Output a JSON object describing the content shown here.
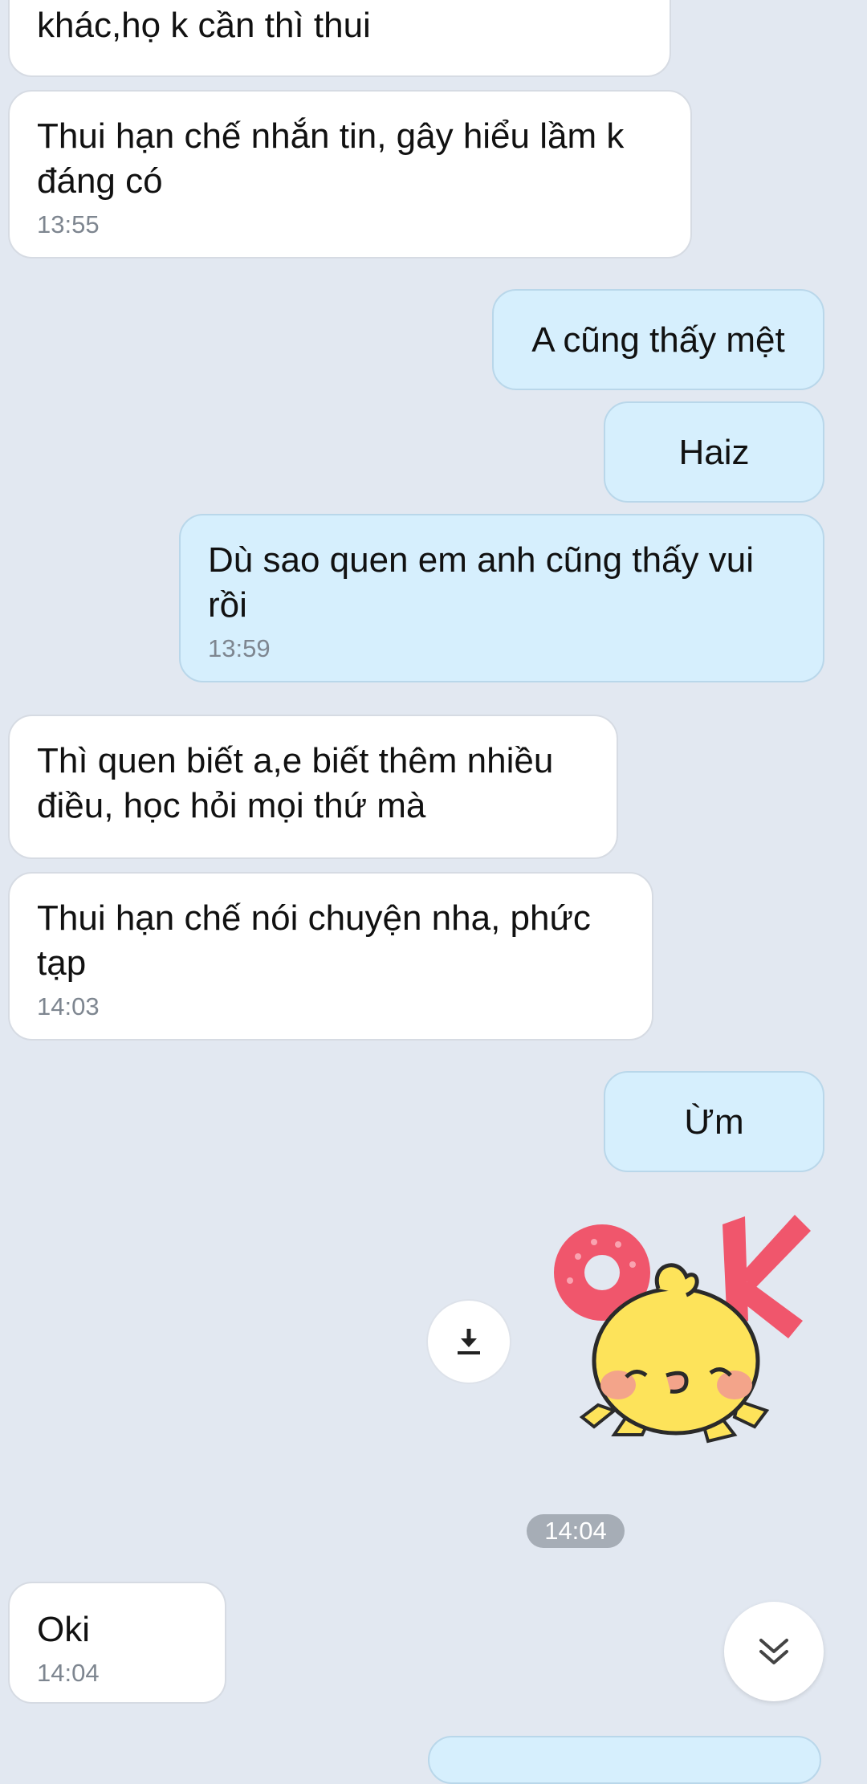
{
  "messages": [
    {
      "side": "in",
      "text": "khác,họ k cần thì thui",
      "time": ""
    },
    {
      "side": "in",
      "text": "Thui hạn chế nhắn tin, gây hiểu lầm k đáng có",
      "time": "13:55"
    },
    {
      "side": "out",
      "text": "A cũng thấy mệt",
      "time": ""
    },
    {
      "side": "out",
      "text": "Haiz",
      "time": ""
    },
    {
      "side": "out",
      "text": "Dù sao quen em anh cũng thấy vui rồi",
      "time": "13:59"
    },
    {
      "side": "in",
      "text": "Thì quen biết a,e biết thêm nhiều điều, học hỏi mọi thứ mà",
      "time": ""
    },
    {
      "side": "in",
      "text": "Thui hạn chế nói chuyện nha, phức tạp",
      "time": "14:03"
    },
    {
      "side": "out",
      "text": "Ừm",
      "time": ""
    },
    {
      "side": "in",
      "text": "Oki",
      "time": "14:04"
    }
  ],
  "sticker": {
    "time": "14:04",
    "text": "OK"
  },
  "icons": {
    "download": "download-icon",
    "scroll": "chevron-double-down-icon"
  },
  "colors": {
    "background": "#e2e8f1",
    "incoming": "#ffffff",
    "outgoing": "#d6effd",
    "sticker_letters": "#f0566c",
    "chick": "#fde35a"
  }
}
